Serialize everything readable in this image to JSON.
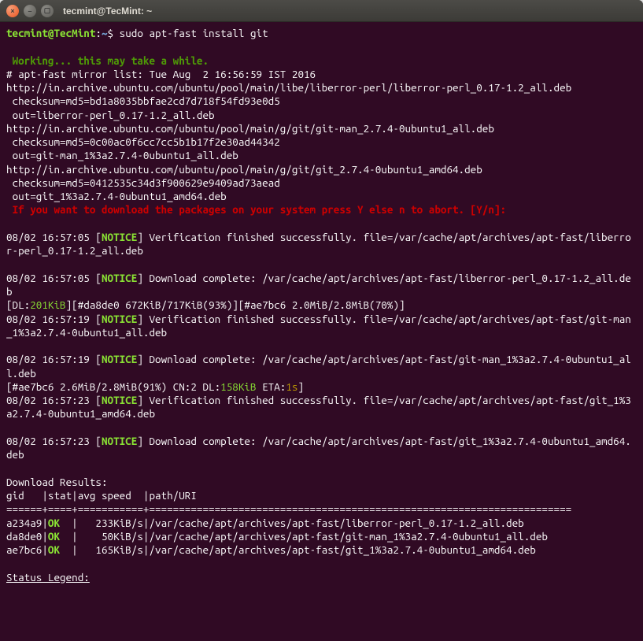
{
  "window": {
    "title": "tecmint@TecMint: ~"
  },
  "prompt": {
    "user_host": "tecmint@TecMint",
    "path": "~",
    "symbol": "$"
  },
  "command": "sudo apt-fast install git",
  "lines": {
    "working": " Working... this may take a while.",
    "mirror_list": "# apt-fast mirror list: Tue Aug  2 16:56:59 IST 2016",
    "url1": "http://in.archive.ubuntu.com/ubuntu/pool/main/libe/liberror-perl/liberror-perl_0.17-1.2_all.deb",
    "chk1": " checksum=md5=bd1a8035bbfae2cd7d718f54fd93e0d5",
    "out1": " out=liberror-perl_0.17-1.2_all.deb",
    "url2": "http://in.archive.ubuntu.com/ubuntu/pool/main/g/git/git-man_2.7.4-0ubuntu1_all.deb",
    "chk2": " checksum=md5=0c00ac0f6cc7cc5b1b17f2e30ad44342",
    "out2": " out=git-man_1%3a2.7.4-0ubuntu1_all.deb",
    "url3": "http://in.archive.ubuntu.com/ubuntu/pool/main/g/git/git_2.7.4-0ubuntu1_amd64.deb",
    "chk3": " checksum=md5=0412535c34d3f900629e9409ad73aead",
    "out3": " out=git_1%3a2.7.4-0ubuntu1_amd64.deb",
    "confirm": " If you want to download the packages on your system press Y else n to abort. [Y/n]:",
    "ts1": "08/02 16:57:05 [",
    "notice": "NOTICE",
    "verif1": "] Verification finished successfully. file=/var/cache/apt/archives/apt-fast/liberror-perl_0.17-1.2_all.deb",
    "ts2": "08/02 16:57:05 [",
    "dl1": "] Download complete: /var/cache/apt/archives/apt-fast/liberror-perl_0.17-1.2_all.deb",
    "progress_pre": "[DL:",
    "progress_dl": "201KiB",
    "progress_post": "][#da8de0 672KiB/717KiB(93%)][#ae7bc6 2.0MiB/2.8MiB(70%)]",
    "ts3": "08/02 16:57:19 [",
    "verif2": "] Verification finished successfully. file=/var/cache/apt/archives/apt-fast/git-man_1%3a2.7.4-0ubuntu1_all.deb",
    "ts4": "08/02 16:57:19 [",
    "dl2": "] Download complete: /var/cache/apt/archives/apt-fast/git-man_1%3a2.7.4-0ubuntu1_all.deb",
    "progress2_pre": "[#ae7bc6 2.6MiB/2.8MiB(91%) CN:2 DL:",
    "progress2_dl": "158KiB",
    "progress2_mid": " ETA:",
    "progress2_eta": "1s",
    "progress2_post": "]",
    "ts5": "08/02 16:57:23 [",
    "verif3": "] Verification finished successfully. file=/var/cache/apt/archives/apt-fast/git_1%3a2.7.4-0ubuntu1_amd64.deb",
    "ts6": "08/02 16:57:23 [",
    "dl3": "] Download complete: /var/cache/apt/archives/apt-fast/git_1%3a2.7.4-0ubuntu1_amd64.deb",
    "results_hdr": "Download Results:",
    "results_cols": "gid   |stat|avg speed  |path/URI",
    "results_sep": "======+====+===========+=======================================================================",
    "r1_gid": "a234a9|",
    "r1_ok": "OK",
    "r1_rest": "  |   233KiB/s|/var/cache/apt/archives/apt-fast/liberror-perl_0.17-1.2_all.deb",
    "r2_gid": "da8de0|",
    "r2_ok": "OK",
    "r2_rest": "  |    50KiB/s|/var/cache/apt/archives/apt-fast/git-man_1%3a2.7.4-0ubuntu1_all.deb",
    "r3_gid": "ae7bc6|",
    "r3_ok": "OK",
    "r3_rest": "  |   165KiB/s|/var/cache/apt/archives/apt-fast/git_1%3a2.7.4-0ubuntu1_amd64.deb",
    "legend": "Status Legend:"
  }
}
